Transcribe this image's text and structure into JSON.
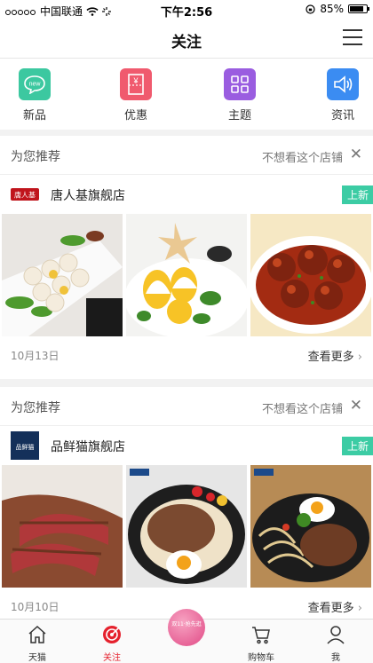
{
  "status_bar": {
    "carrier": "中国联通",
    "time": "下午2:56",
    "battery": "85%",
    "battery_fraction": 0.85
  },
  "header": {
    "title": "关注"
  },
  "categories": [
    {
      "label": "新品",
      "icon": "new-badge-icon",
      "icon_text": "new",
      "color": "#3cc8a0"
    },
    {
      "label": "优惠",
      "icon": "coupon-icon",
      "icon_text": "¥",
      "color": "#f05a6e"
    },
    {
      "label": "主题",
      "icon": "grid-icon",
      "color": "#9a5de0"
    },
    {
      "label": "资讯",
      "icon": "speaker-icon",
      "color": "#3b8cf2"
    }
  ],
  "recommendations": [
    {
      "heading": "为您推荐",
      "dismiss": "不想看这个店铺",
      "shop_name": "唐人基旗舰店",
      "logo_text": "唐人基",
      "badge": "上新",
      "date": "10月13日",
      "more": "查看更多",
      "images": [
        "dumplings-photo",
        "egg-dish-photo",
        "meatballs-photo"
      ]
    },
    {
      "heading": "为您推荐",
      "dismiss": "不想看这个店铺",
      "shop_name": "品鲜猫旗舰店",
      "logo_text": "品鲜猫",
      "badge": "上新",
      "date": "10月10日",
      "more": "查看更多",
      "images": [
        "steak-slices-photo",
        "steak-egg-photo",
        "steak-plate-photo"
      ]
    }
  ],
  "tabbar": {
    "items": [
      {
        "label": "天猫",
        "icon": "home-icon"
      },
      {
        "label": "关注",
        "icon": "target-icon",
        "active": true
      },
      {
        "label": "",
        "icon": "promo-badge",
        "promo_text": "双11·抢先逛"
      },
      {
        "label": "购物车",
        "icon": "cart-icon"
      },
      {
        "label": "我",
        "icon": "person-icon"
      }
    ]
  }
}
